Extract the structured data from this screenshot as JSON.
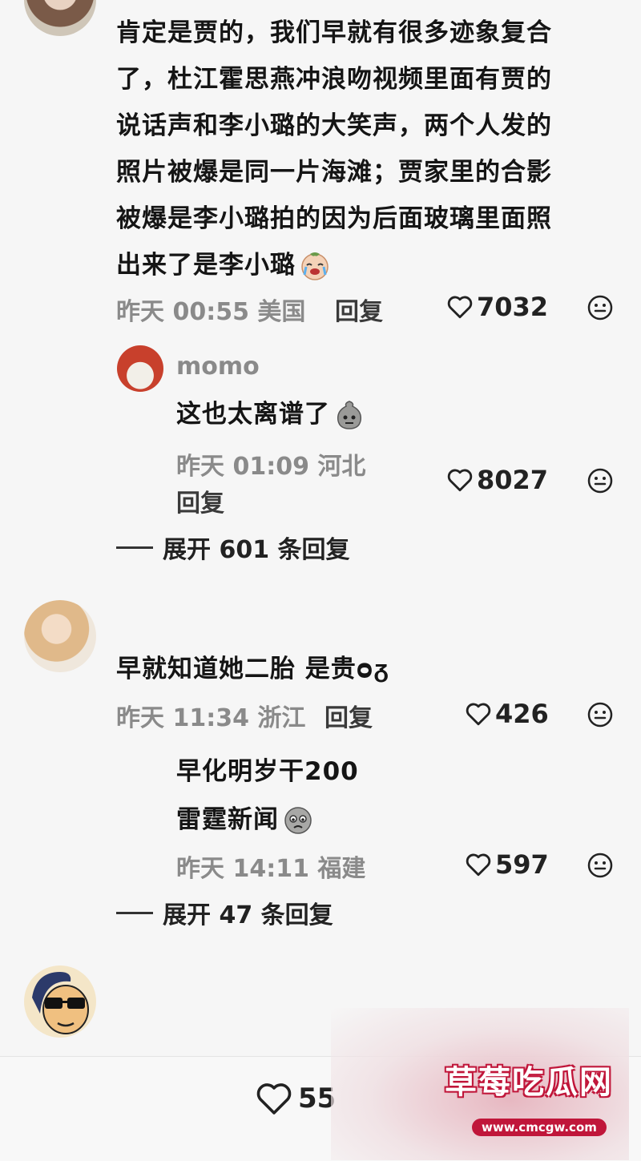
{
  "comments": [
    {
      "text_lines": [
        "肯定是贾的，我们早就有很多迹象复合",
        "了，杜江霍思燕冲浪吻视频里面有贾的",
        "说话声和李小璐的大笑声，两个人发的",
        "照片被爆是同一片海滩；贾家里的合影",
        "被爆是李小璐拍的因为后面玻璃里面照",
        "出来了是李小璐"
      ],
      "meta": "昨天 00:55 美国",
      "reply_label": "回复",
      "likes": "7032",
      "replies": [
        {
          "username": "momo",
          "text": "这也太离谱了",
          "meta": "昨天 01:09 河北",
          "reply_label": "回复",
          "likes": "8027"
        }
      ],
      "expand_label": "展开 601 条回复"
    },
    {
      "text": "早就知道她二胎 是贵ᴑᵹ",
      "meta": "昨天 11:34 浙江",
      "reply_label": "回复",
      "likes": "426",
      "replies": [
        {
          "text_line1": "早化明岁干200",
          "text_line2": "雷霆新闻",
          "meta": "昨天 14:11 福建",
          "likes": "597"
        }
      ],
      "expand_label": "展开 47 条回复"
    }
  ],
  "bottom_bar": {
    "likes": "55"
  },
  "watermark": {
    "title": "草莓吃瓜网",
    "url": "www.cmcgw.com"
  }
}
